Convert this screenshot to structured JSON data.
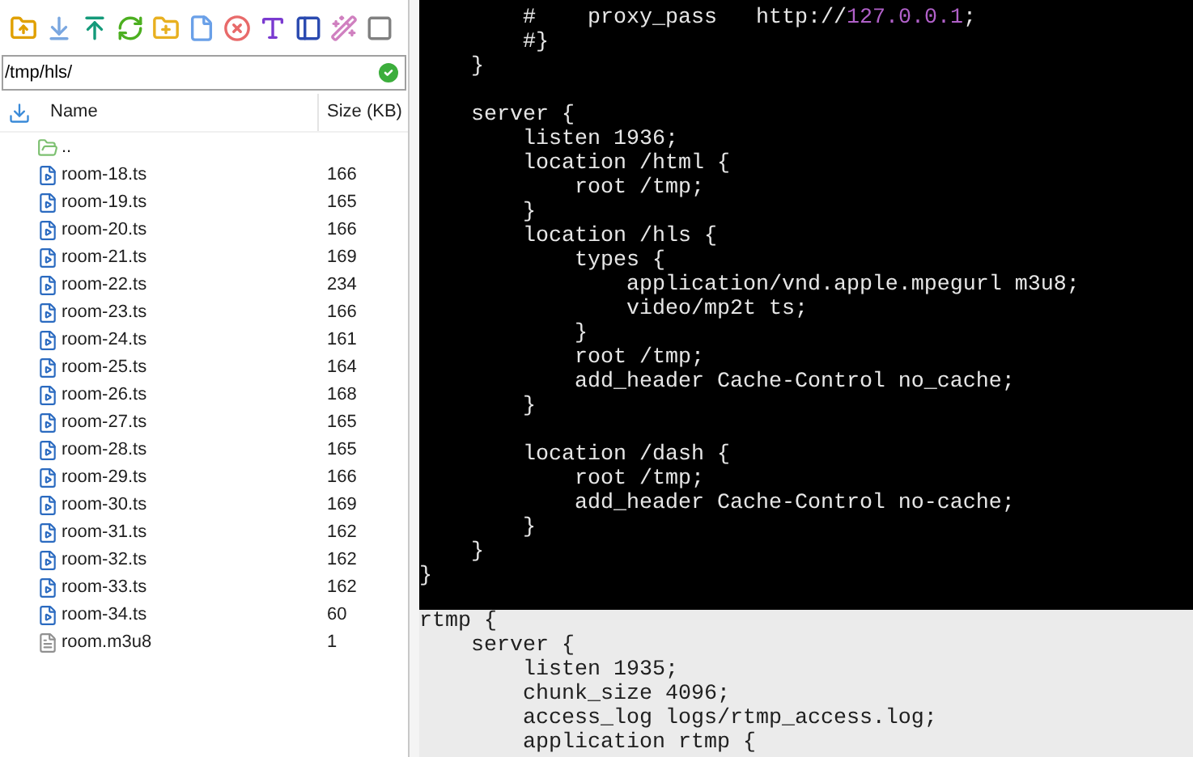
{
  "file_panel": {
    "path": {
      "value": "/tmp/hls/"
    },
    "columns": [
      "Name",
      "Size (KB)"
    ],
    "rows": [
      {
        "kind": "parent",
        "name": ".."
      },
      {
        "kind": "video",
        "name": "room-18.ts",
        "size": "166"
      },
      {
        "kind": "video",
        "name": "room-19.ts",
        "size": "165"
      },
      {
        "kind": "video",
        "name": "room-20.ts",
        "size": "166"
      },
      {
        "kind": "video",
        "name": "room-21.ts",
        "size": "169"
      },
      {
        "kind": "video",
        "name": "room-22.ts",
        "size": "234"
      },
      {
        "kind": "video",
        "name": "room-23.ts",
        "size": "166"
      },
      {
        "kind": "video",
        "name": "room-24.ts",
        "size": "161"
      },
      {
        "kind": "video",
        "name": "room-25.ts",
        "size": "164"
      },
      {
        "kind": "video",
        "name": "room-26.ts",
        "size": "168"
      },
      {
        "kind": "video",
        "name": "room-27.ts",
        "size": "165"
      },
      {
        "kind": "video",
        "name": "room-28.ts",
        "size": "165"
      },
      {
        "kind": "video",
        "name": "room-29.ts",
        "size": "166"
      },
      {
        "kind": "video",
        "name": "room-30.ts",
        "size": "169"
      },
      {
        "kind": "video",
        "name": "room-31.ts",
        "size": "162"
      },
      {
        "kind": "video",
        "name": "room-32.ts",
        "size": "162"
      },
      {
        "kind": "video",
        "name": "room-33.ts",
        "size": "162"
      },
      {
        "kind": "video",
        "name": "room-34.ts",
        "size": "60"
      },
      {
        "kind": "file",
        "name": "room.m3u8",
        "size": "1"
      }
    ]
  },
  "terminal": {
    "lines": [
      {
        "kind": "code",
        "text": "        #    proxy_pass   http://",
        "highlight": "127.0.0.1",
        "after": ";"
      },
      {
        "kind": "code",
        "text": "        #}"
      },
      {
        "kind": "code",
        "text": "    }"
      },
      {
        "kind": "blank"
      },
      {
        "kind": "code",
        "text": "    server {"
      },
      {
        "kind": "code",
        "text": "        listen 1936;"
      },
      {
        "kind": "code",
        "text": "        location /html {"
      },
      {
        "kind": "code",
        "text": "            root /tmp;"
      },
      {
        "kind": "code",
        "text": "        }"
      },
      {
        "kind": "code",
        "text": "        location /hls {"
      },
      {
        "kind": "code",
        "text": "            types {"
      },
      {
        "kind": "code",
        "text": "                application/vnd.apple.mpegurl m3u8;"
      },
      {
        "kind": "code",
        "text": "                video/mp2t ts;"
      },
      {
        "kind": "code",
        "text": "            }"
      },
      {
        "kind": "code",
        "text": "            root /tmp;"
      },
      {
        "kind": "code",
        "text": "            add_header Cache-Control no_cache;"
      },
      {
        "kind": "code",
        "text": "        }"
      },
      {
        "kind": "blank"
      },
      {
        "kind": "code",
        "text": "        location /dash {"
      },
      {
        "kind": "code",
        "text": "            root /tmp;"
      },
      {
        "kind": "code",
        "text": "            add_header Cache-Control no-cache;"
      },
      {
        "kind": "code",
        "text": "        }"
      },
      {
        "kind": "code",
        "text": "    }"
      },
      {
        "kind": "code",
        "text": "}"
      }
    ]
  },
  "lower_pane": {
    "lines": [
      {
        "kind": "code",
        "text": "rtmp {"
      },
      {
        "kind": "code",
        "text": "    server {"
      },
      {
        "kind": "code",
        "text": "        listen 1935;"
      },
      {
        "kind": "code",
        "text": "        chunk_size 4096;"
      },
      {
        "kind": "code",
        "text": "        access_log logs/rtmp_access.log;"
      },
      {
        "kind": "code",
        "text": "        application rtmp {"
      }
    ]
  }
}
